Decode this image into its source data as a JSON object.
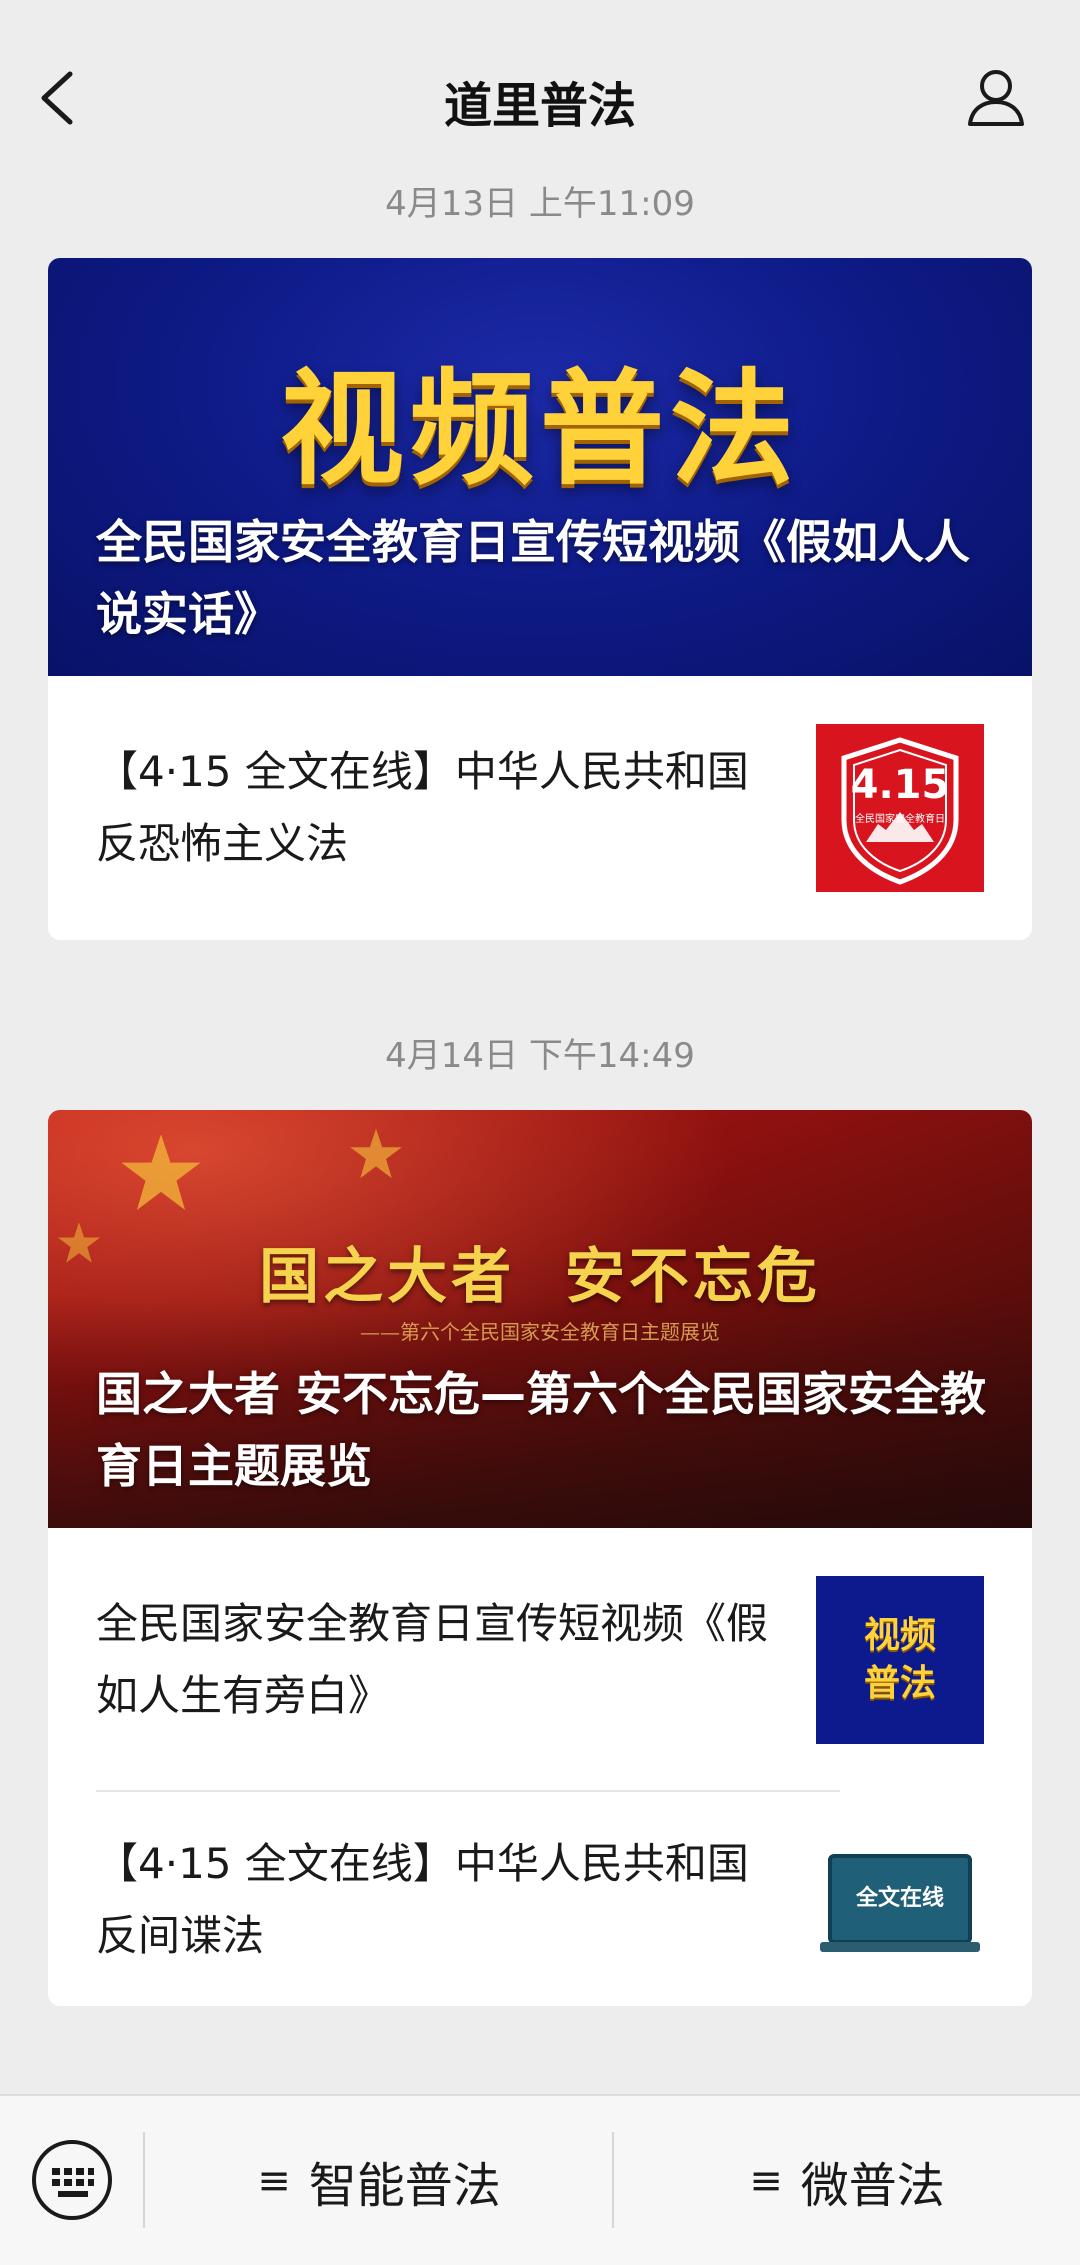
{
  "header": {
    "title": "道里普法",
    "back_icon": "chevron-left-icon",
    "profile_icon": "person-icon"
  },
  "messages": [
    {
      "timestamp": "4月13日 上午11:09",
      "cover": {
        "banner_title": "视频普法",
        "headline": "全民国家安全教育日宣传短视频《假如人人说实话》"
      },
      "items": [
        {
          "title": "【4·15 全文在线】中华人民共和国反恐怖主义法",
          "thumb_text": "4.15",
          "thumb_sub": "全民国家安全教育日"
        }
      ]
    },
    {
      "timestamp": "4月14日 下午14:49",
      "cover": {
        "banner_title": "国之大者  安不忘危",
        "banner_sub": "——第六个全民国家安全教育日主题展览",
        "headline": "国之大者 安不忘危—第六个全民国家安全教育日主题展览"
      },
      "items": [
        {
          "title": "全民国家安全教育日宣传短视频《假如人生有旁白》",
          "thumb_text": "视频普法"
        },
        {
          "title": "【4·15 全文在线】中华人民共和国反间谍法",
          "thumb_text": "全文在线"
        }
      ]
    }
  ],
  "bottom_bar": {
    "keyboard_icon": "keyboard-icon",
    "menus": [
      {
        "label": "智能普法",
        "icon": "≡"
      },
      {
        "label": "微普法",
        "icon": "≡"
      }
    ]
  },
  "colors": {
    "background": "#ededed",
    "blue_banner": "#0e1a86",
    "gold_text": "#ffd23a",
    "red_banner": "#8e110f",
    "thumb_red": "#d8141e"
  }
}
